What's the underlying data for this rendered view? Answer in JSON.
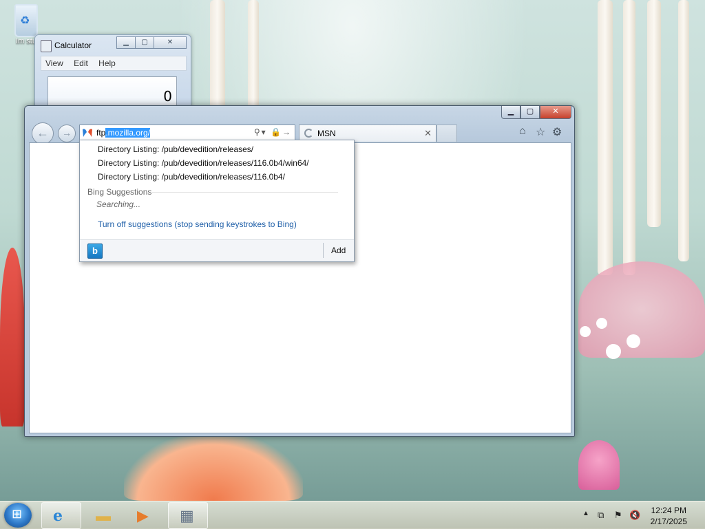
{
  "desktop": {
    "recycle_label": "Im stu"
  },
  "calculator": {
    "title": "Calculator",
    "menu": [
      "View",
      "Edit",
      "Help"
    ],
    "display_value": "0"
  },
  "browser": {
    "address": {
      "prefix": "ftp",
      "selected": ".mozilla.org/"
    },
    "tab": {
      "label": "MSN"
    },
    "dropdown": {
      "history": [
        "Directory Listing: /pub/devedition/releases/",
        "Directory Listing: /pub/devedition/releases/116.0b4/win64/",
        "Directory Listing: /pub/devedition/releases/116.0b4/"
      ],
      "suggestions_header": "Bing Suggestions",
      "searching": "Searching...",
      "turn_off": "Turn off suggestions (stop sending keystrokes to Bing)",
      "provider_icon": "b",
      "add_label": "Add"
    }
  },
  "taskbar": {
    "apps": [
      "internet-explorer-icon",
      "folder-icon",
      "media-player-icon",
      "calculator-icon"
    ],
    "clock": {
      "time": "12:24 PM",
      "date": "2/17/2025"
    }
  },
  "colors": {
    "selection": "#3399ff",
    "link": "#1f5fa8",
    "close_button": "#c7412c"
  }
}
